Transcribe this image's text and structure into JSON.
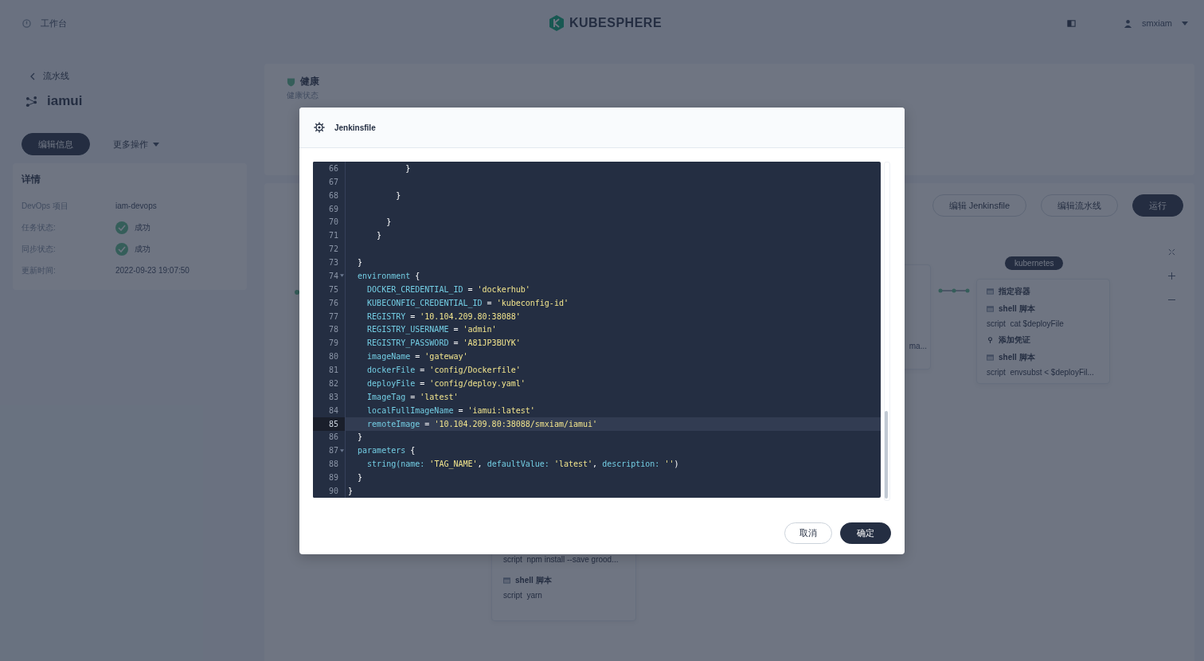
{
  "top_bar": {
    "workbench": "工作台",
    "logo": "KUBESPHERE",
    "user": "smxiam"
  },
  "sidebar": {
    "back_label": "流水线",
    "title": "iamui",
    "buttons": [
      {
        "label": "编辑信息",
        "kind": "primary"
      },
      {
        "label": "更多操作",
        "kind": "dropdown"
      }
    ],
    "section_title": "详情",
    "details": [
      {
        "label": "DevOps 项目",
        "value": "iam-devops",
        "kind": "text"
      },
      {
        "label": "任务状态:",
        "value": "成功",
        "kind": "status"
      },
      {
        "label": "同步状态:",
        "value": "成功",
        "kind": "status"
      },
      {
        "label": "更新时间:",
        "value": "2022-09-23 19:07:50",
        "kind": "text"
      }
    ]
  },
  "health": {
    "title": "健康",
    "subtitle": "健康状态"
  },
  "toolbar": {
    "buttons": [
      {
        "label": "编辑 Jenkinsfile",
        "kind": "default"
      },
      {
        "label": "编辑流水线",
        "kind": "default"
      },
      {
        "label": "运行",
        "kind": "primary"
      }
    ]
  },
  "pipeline": {
    "cut_text": "ma...",
    "tag": "kubernetes",
    "right_steps": [
      {
        "kind": "container",
        "title": "指定容器"
      },
      {
        "kind": "shell",
        "title": "shell 脚本",
        "script_label": "script",
        "script": "cat $deployFile"
      },
      {
        "kind": "credential",
        "title": "添加凭证"
      },
      {
        "kind": "shell",
        "title": "shell 脚本",
        "script_label": "script",
        "script": "envsubst < $deployFil..."
      }
    ],
    "bottom_steps": [
      {
        "kind": "script",
        "script_label": "script",
        "script": "npm install --save grood..."
      },
      {
        "kind": "shell",
        "title": "shell 脚本",
        "script_label": "script",
        "script": "yarn"
      }
    ]
  },
  "modal": {
    "title": "Jenkinsfile",
    "buttons": [
      {
        "label": "取消",
        "kind": "default"
      },
      {
        "label": "确定",
        "kind": "primary"
      }
    ],
    "code_lines": [
      {
        "number": "66",
        "active": false,
        "foldable": false,
        "tokens": [
          {
            "kind": "plain",
            "text": "            }"
          }
        ]
      },
      {
        "number": "67",
        "active": false,
        "foldable": false
      },
      {
        "number": "68",
        "active": false,
        "foldable": false,
        "tokens": [
          {
            "kind": "plain",
            "text": "          }"
          }
        ]
      },
      {
        "number": "69",
        "active": false,
        "foldable": false
      },
      {
        "number": "70",
        "active": false,
        "foldable": false,
        "tokens": [
          {
            "kind": "plain",
            "text": "        }"
          }
        ]
      },
      {
        "number": "71",
        "active": false,
        "foldable": false,
        "tokens": [
          {
            "kind": "plain",
            "text": "      }"
          }
        ]
      },
      {
        "number": "72",
        "active": false,
        "foldable": false
      },
      {
        "number": "73",
        "active": false,
        "foldable": false,
        "tokens": [
          {
            "kind": "plain",
            "text": "  }"
          }
        ]
      },
      {
        "number": "74",
        "active": false,
        "foldable": true,
        "tokens": [
          {
            "kind": "ident",
            "text": "  environment"
          },
          {
            "kind": "plain",
            "text": " {"
          }
        ]
      },
      {
        "number": "75",
        "active": false,
        "foldable": false,
        "tokens": [
          {
            "kind": "ident",
            "text": "    DOCKER_CREDENTIAL_ID"
          },
          {
            "kind": "plain",
            "text": " = "
          },
          {
            "kind": "string",
            "text": "'dockerhub'"
          }
        ]
      },
      {
        "number": "76",
        "active": false,
        "foldable": false,
        "tokens": [
          {
            "kind": "ident",
            "text": "    KUBECONFIG_CREDENTIAL_ID"
          },
          {
            "kind": "plain",
            "text": " = "
          },
          {
            "kind": "string",
            "text": "'kubeconfig-id'"
          }
        ]
      },
      {
        "number": "77",
        "active": false,
        "foldable": false,
        "tokens": [
          {
            "kind": "ident",
            "text": "    REGISTRY"
          },
          {
            "kind": "plain",
            "text": " = "
          },
          {
            "kind": "string",
            "text": "'10.104.209.80:38088'"
          }
        ]
      },
      {
        "number": "78",
        "active": false,
        "foldable": false,
        "tokens": [
          {
            "kind": "ident",
            "text": "    REGISTRY_USERNAME"
          },
          {
            "kind": "plain",
            "text": " = "
          },
          {
            "kind": "string",
            "text": "'admin'"
          }
        ]
      },
      {
        "number": "79",
        "active": false,
        "foldable": false,
        "tokens": [
          {
            "kind": "ident",
            "text": "    REGISTRY_PASSWORD"
          },
          {
            "kind": "plain",
            "text": " = "
          },
          {
            "kind": "string",
            "text": "'A81JP3BUYK'"
          }
        ]
      },
      {
        "number": "80",
        "active": false,
        "foldable": false,
        "tokens": [
          {
            "kind": "ident",
            "text": "    imageName"
          },
          {
            "kind": "plain",
            "text": " = "
          },
          {
            "kind": "string",
            "text": "'gateway'"
          }
        ]
      },
      {
        "number": "81",
        "active": false,
        "foldable": false,
        "tokens": [
          {
            "kind": "ident",
            "text": "    dockerFile"
          },
          {
            "kind": "plain",
            "text": " = "
          },
          {
            "kind": "string",
            "text": "'config/Dockerfile'"
          }
        ]
      },
      {
        "number": "82",
        "active": false,
        "foldable": false,
        "tokens": [
          {
            "kind": "ident",
            "text": "    deployFile"
          },
          {
            "kind": "plain",
            "text": " = "
          },
          {
            "kind": "string",
            "text": "'config/deploy.yaml'"
          }
        ]
      },
      {
        "number": "83",
        "active": false,
        "foldable": false,
        "tokens": [
          {
            "kind": "ident",
            "text": "    ImageTag"
          },
          {
            "kind": "plain",
            "text": " = "
          },
          {
            "kind": "string",
            "text": "'latest'"
          }
        ]
      },
      {
        "number": "84",
        "active": false,
        "foldable": false,
        "tokens": [
          {
            "kind": "ident",
            "text": "    localFullImageName"
          },
          {
            "kind": "plain",
            "text": " = "
          },
          {
            "kind": "string",
            "text": "'iamui:latest'"
          }
        ]
      },
      {
        "number": "85",
        "active": true,
        "foldable": false,
        "tokens": [
          {
            "kind": "ident",
            "text": "    remoteImage"
          },
          {
            "kind": "plain",
            "text": " = "
          },
          {
            "kind": "string",
            "text": "'10.104.209.80:38088/smxiam/iamui'"
          }
        ]
      },
      {
        "number": "86",
        "active": false,
        "foldable": false,
        "tokens": [
          {
            "kind": "plain",
            "text": "  }"
          }
        ]
      },
      {
        "number": "87",
        "active": false,
        "foldable": true,
        "tokens": [
          {
            "kind": "ident",
            "text": "  parameters"
          },
          {
            "kind": "plain",
            "text": " {"
          }
        ]
      },
      {
        "number": "88",
        "active": false,
        "foldable": false,
        "tokens": [
          {
            "kind": "ident",
            "text": "    string(name: "
          },
          {
            "kind": "string",
            "text": "'TAG_NAME'"
          },
          {
            "kind": "plain",
            "text": ", "
          },
          {
            "kind": "ident",
            "text": "defaultValue: "
          },
          {
            "kind": "string",
            "text": "'latest'"
          },
          {
            "kind": "plain",
            "text": ", "
          },
          {
            "kind": "ident",
            "text": "description: "
          },
          {
            "kind": "string",
            "text": "''"
          },
          {
            "kind": "plain",
            "text": ")"
          }
        ]
      },
      {
        "number": "89",
        "active": false,
        "foldable": false,
        "tokens": [
          {
            "kind": "plain",
            "text": "  }"
          }
        ]
      },
      {
        "number": "90",
        "active": false,
        "foldable": false,
        "tokens": [
          {
            "kind": "plain",
            "text": "}"
          }
        ]
      }
    ]
  }
}
